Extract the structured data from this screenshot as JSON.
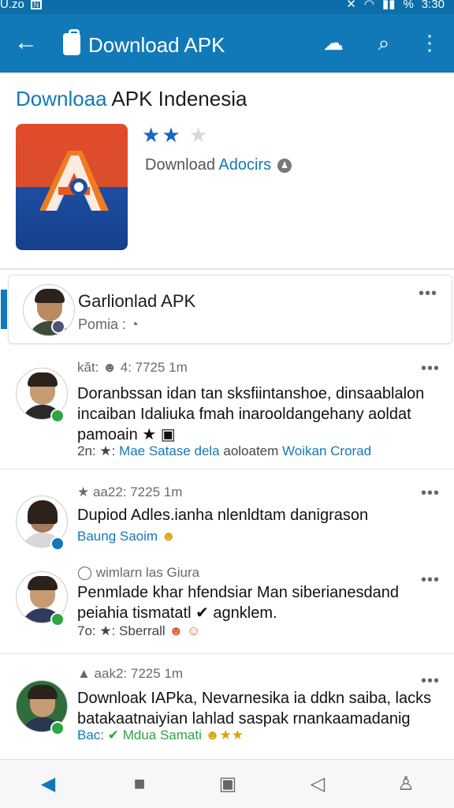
{
  "status_bar": {
    "time_left": "U.zo",
    "time_right": "3:30",
    "battery": "%",
    "sim": "N"
  },
  "app_bar": {
    "title": "Download APK"
  },
  "hero": {
    "title_hl": "Downloaa",
    "title_rest": " APK Indenesia",
    "rating": 2,
    "rating_max": 3,
    "download_label": "Download ",
    "download_source": "Adocirs"
  },
  "featured": {
    "name": "Garlionlad APK",
    "sub": "Pomia :"
  },
  "posts": [
    {
      "meta": "kăt: ☻ 4: 7725 1m",
      "body1": "Doranbssan idan tan sksfiintanshoe, dinsaablalon",
      "body2": "incaiban Idaliuka fmah inarooldangehany aoldat",
      "body3": "pamoain ★ ▣",
      "foot_a": "2n: ★: ",
      "foot_b": "Mae Satase dela",
      "foot_c": " aoloatem ",
      "foot_d": "Woikan Crorad"
    },
    {
      "meta": "★ aa22: 7225 1m",
      "body1": "Dupiod Adles.ianha nlenldtam danigrason",
      "foot_a": "Baung Saoim",
      "emoji": "☻"
    },
    {
      "meta": "◯ wimlarn las Giura",
      "body1": "Penmlade khar hfendsiar Man siberianesdand",
      "body2": "peiahia tismatatl ✔ agnklem.",
      "foot_a": "7o: ★: Sberrall",
      "emoji": "☻ ☺"
    },
    {
      "meta": "▲ aak2: 7225 1m",
      "body1": "Downloak IAPka, Nevarnesika ia ddkn saiba, lacks",
      "body2": "batakaatnaiyian lahlad saspak rnankaamadanig",
      "foot_a": "Bac: ",
      "foot_b": "✔ Mdua Samati",
      "emoji": "☻★★"
    }
  ],
  "bottom_nav": [
    "back-arrow",
    "square",
    "book",
    "bell",
    "profile"
  ],
  "colors": {
    "primary": "#1279b8",
    "star": "#1a66c2",
    "green_badge": "#2ba640"
  }
}
